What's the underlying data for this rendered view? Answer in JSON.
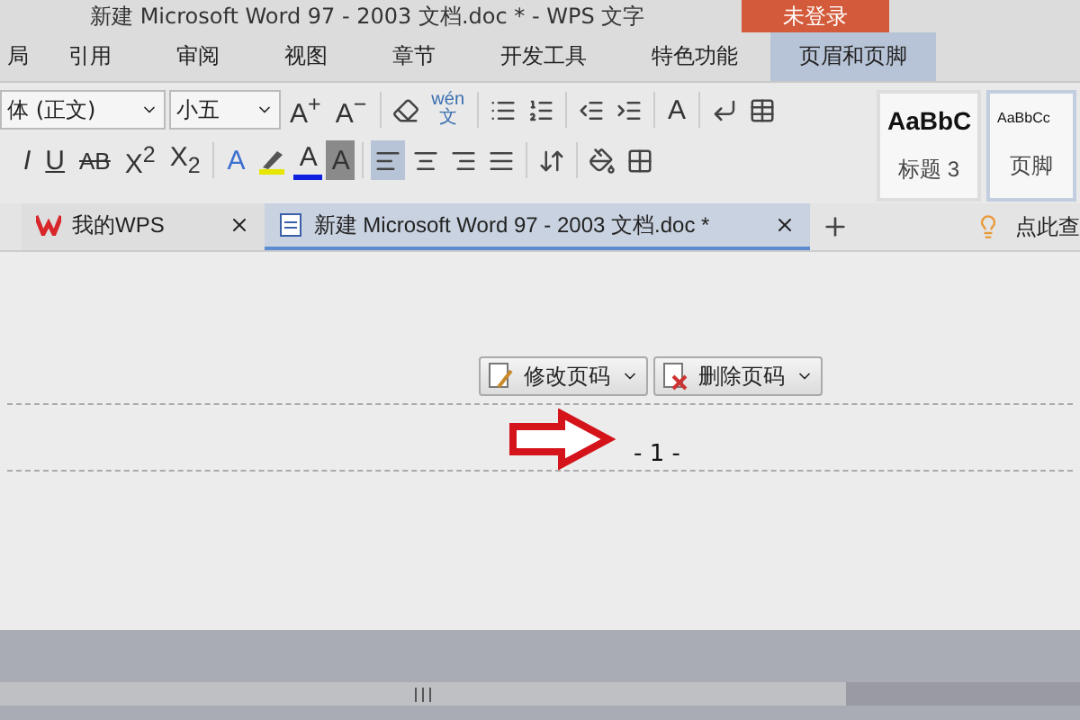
{
  "window": {
    "title": "新建 Microsoft Word 97 - 2003 文档.doc * - WPS 文字",
    "login": "未登录"
  },
  "menu_tabs": [
    {
      "label": "局",
      "selected": false
    },
    {
      "label": "引用",
      "selected": false
    },
    {
      "label": "审阅",
      "selected": false
    },
    {
      "label": "视图",
      "selected": false
    },
    {
      "label": "章节",
      "selected": false
    },
    {
      "label": "开发工具",
      "selected": false
    },
    {
      "label": "特色功能",
      "selected": false
    },
    {
      "label": "页眉和页脚",
      "selected": true
    }
  ],
  "ribbon": {
    "font": "体 (正文)",
    "size": "小五",
    "grow": "A$^{+}$",
    "shrink": "A$^{−}$",
    "pinyin": "wén",
    "pinyin_char": "文",
    "case": "A",
    "italic": "I",
    "underline": "U",
    "strike": "AB",
    "superscript": "X$^{2}$",
    "subscript": "X$_{2}$",
    "effects": "A",
    "font_color": "A",
    "shading": "A",
    "styles": [
      {
        "sample": "AaBbC",
        "name": "标题 3",
        "selected": false
      },
      {
        "sample": "AaBbCc",
        "name": "页脚",
        "selected": true
      }
    ]
  },
  "doc_tabs": [
    {
      "label": "我的WPS",
      "selected": false
    },
    {
      "label": "新建 Microsoft Word 97 - 2003 文档.doc *",
      "selected": true
    }
  ],
  "tip": "点此查",
  "header": {
    "buttons": [
      "修改页码",
      "删除页码"
    ],
    "page_number": "- 1 -"
  }
}
